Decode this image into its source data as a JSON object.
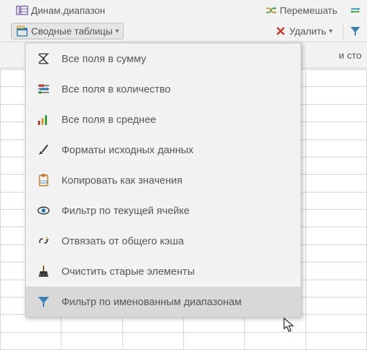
{
  "ribbon": {
    "dyn_range": "Динам.диапазон",
    "pivot_tables": "Сводные таблицы",
    "shuffle": "Перемешать",
    "delete": "Удалить",
    "hidden_cols_fragment": "и сто"
  },
  "menu": {
    "items": [
      {
        "label": "Все поля в сумму"
      },
      {
        "label": "Все поля в количество"
      },
      {
        "label": "Все поля в среднее"
      },
      {
        "label": "Форматы исходных данных"
      },
      {
        "label": "Копировать как значения"
      },
      {
        "label": "Фильтр по текущей ячейке"
      },
      {
        "label": "Отвязать от общего кэша"
      },
      {
        "label": "Очистить старые элементы"
      },
      {
        "label": "Фильтр по именованным диапазонам"
      }
    ]
  }
}
